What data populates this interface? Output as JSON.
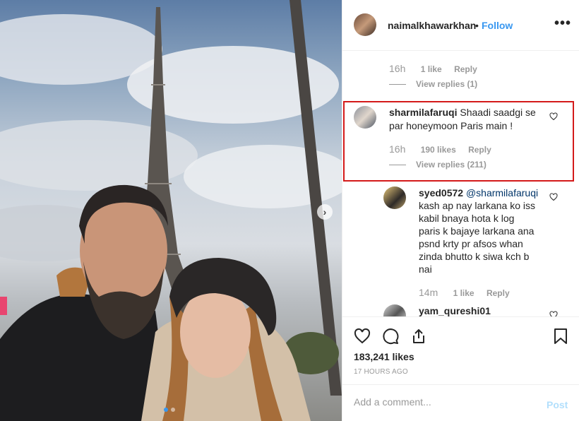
{
  "header": {
    "username": "naimalkhawarkhan",
    "separator": "•",
    "follow_label": "Follow",
    "more_label": "•••"
  },
  "comments": [
    {
      "time": "16h",
      "likes": "1 like",
      "reply": "Reply",
      "view_replies": "View replies (1)"
    },
    {
      "user": "sharmilafaruqi",
      "text": "Shaadi saadgi se par honeymoon Paris main !",
      "time": "16h",
      "likes": "190 likes",
      "reply": "Reply",
      "view_replies": "View replies (211)"
    }
  ],
  "replies": [
    {
      "user": "syed0572",
      "mention": "@sharmilafaruqi",
      "text_lines": [
        "kash ap nay larkana ko iss",
        "kabil bnaya hota k log",
        "paris k bajaye larkana ana",
        "psnd krty pr afsos whan",
        "zinda bhutto k siwa kch b",
        "nai"
      ],
      "time": "14m",
      "likes": "1 like",
      "reply": "Reply"
    },
    {
      "user": "yam_qureshi01"
    }
  ],
  "post": {
    "likes": "183,241 likes",
    "time_ago": "17 HOURS AGO"
  },
  "add_comment": {
    "placeholder": "Add a comment...",
    "post_label": "Post"
  },
  "icons": {
    "like": "heart-icon",
    "comment": "comment-icon",
    "share": "share-icon",
    "save": "bookmark-icon",
    "next": "chevron-right-icon"
  },
  "colors": {
    "link": "#3897f0",
    "highlight": "#d41a1a",
    "post_disabled": "#b2dffc"
  }
}
